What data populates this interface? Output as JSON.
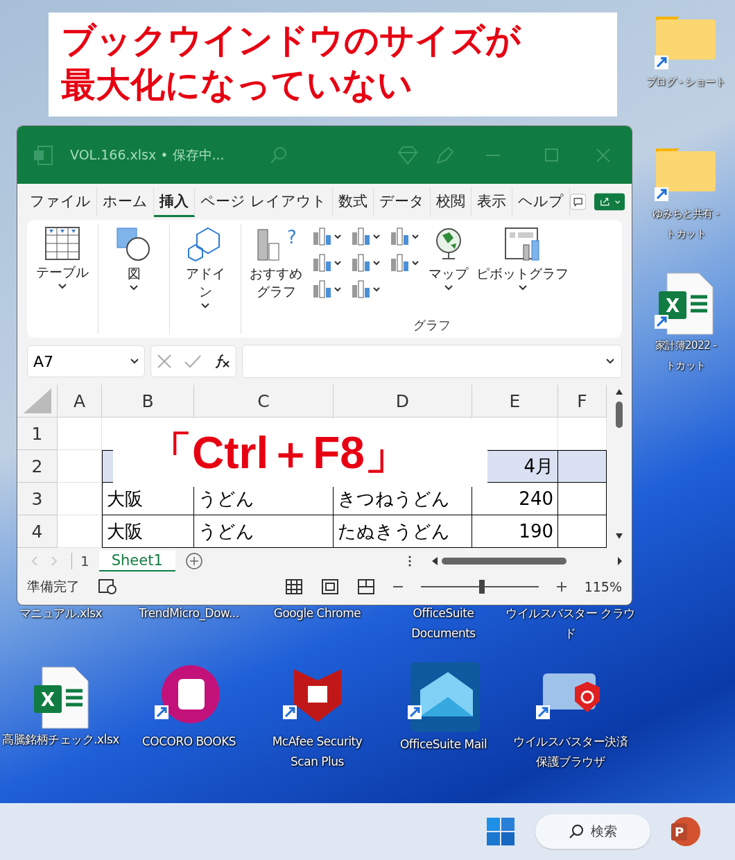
{
  "annotation": {
    "lines": [
      "ブックウインドウのサイズが",
      "最大化になっていない"
    ]
  },
  "desktop_icons": [
    {
      "kind": "folder",
      "lines": [
        "ブログ - ショート"
      ]
    },
    {
      "kind": "folder",
      "lines": [
        "ゆみちと共有 -",
        "トカット"
      ]
    },
    {
      "kind": "excel-shortcut",
      "badge": "X",
      "lines": [
        "家計簿2022 -",
        "トカット"
      ]
    },
    {
      "kind": "hidden",
      "lines": [
        "マニュアル.xlsx"
      ]
    },
    {
      "kind": "hidden",
      "lines": [
        "TrendMicro_Dow..."
      ]
    },
    {
      "kind": "hidden",
      "lines": [
        "Google Chrome"
      ]
    },
    {
      "kind": "hidden",
      "lines": [
        "OfficeSuite",
        "Documents"
      ]
    },
    {
      "kind": "hidden",
      "lines": [
        "ウイルスバスター クラウ",
        "ド"
      ]
    },
    {
      "kind": "excel",
      "badge": "X",
      "lines": [
        "高騰銘柄チェック.xlsx"
      ]
    },
    {
      "kind": "book",
      "lines": [
        "COCORO BOOKS"
      ]
    },
    {
      "kind": "shield",
      "lines": [
        "McAfee Security",
        "Scan Plus"
      ]
    },
    {
      "kind": "mail",
      "lines": [
        "OfficeSuite Mail"
      ]
    },
    {
      "kind": "card",
      "lines": [
        "ウイルスバスター決済",
        "保護ブラウザ"
      ]
    }
  ],
  "excel": {
    "title": "VOL.166.xlsx • 保存中...",
    "tabs": [
      {
        "label": "ファイル",
        "selected": false
      },
      {
        "label": "ホーム",
        "selected": false
      },
      {
        "label": "挿入",
        "selected": true
      },
      {
        "label": "ページ レイアウト",
        "selected": false
      },
      {
        "label": "数式",
        "selected": false
      },
      {
        "label": "データ",
        "selected": false
      },
      {
        "label": "校閲",
        "selected": false
      },
      {
        "label": "表示",
        "selected": false
      },
      {
        "label": "ヘルプ",
        "selected": false
      }
    ],
    "ribbon": [
      {
        "kind": "table",
        "label": "テーブル"
      },
      {
        "kind": "shapes",
        "label": "図"
      },
      {
        "kind": "addin",
        "label": "アドイン"
      }
    ],
    "chart_group": {
      "recommended": "おすすめグラフ",
      "recommended_mark": "?",
      "map": "マップ",
      "pivot": "ピボットグラフ",
      "label": "グラフ"
    },
    "name_box": "A7",
    "columns": [
      "A",
      "B",
      "C",
      "D",
      "E",
      "F"
    ],
    "rows": [
      {
        "label": "1",
        "kind": "blank",
        "cells": [
          "",
          "",
          "",
          "",
          "",
          ""
        ]
      },
      {
        "label": "2",
        "kind": "header",
        "cells": [
          "",
          "",
          "",
          "",
          "4月",
          ""
        ]
      },
      {
        "label": "3",
        "kind": "data",
        "cells": [
          "",
          "大阪",
          "うどん",
          "きつねうどん",
          "240",
          ""
        ]
      },
      {
        "label": "4",
        "kind": "data",
        "cells": [
          "",
          "大阪",
          "うどん",
          "たぬきうどん",
          "190",
          ""
        ]
      }
    ],
    "sheet_count": "1",
    "sheets": [
      {
        "label": "Sheet1",
        "selected": true
      }
    ],
    "status": "準備完了",
    "zoom": {
      "level": 0.52,
      "reading": "115%"
    }
  },
  "shortcut": "「Ctrl＋F8」",
  "taskbar": {
    "search": "検索",
    "app_letter": "P"
  }
}
